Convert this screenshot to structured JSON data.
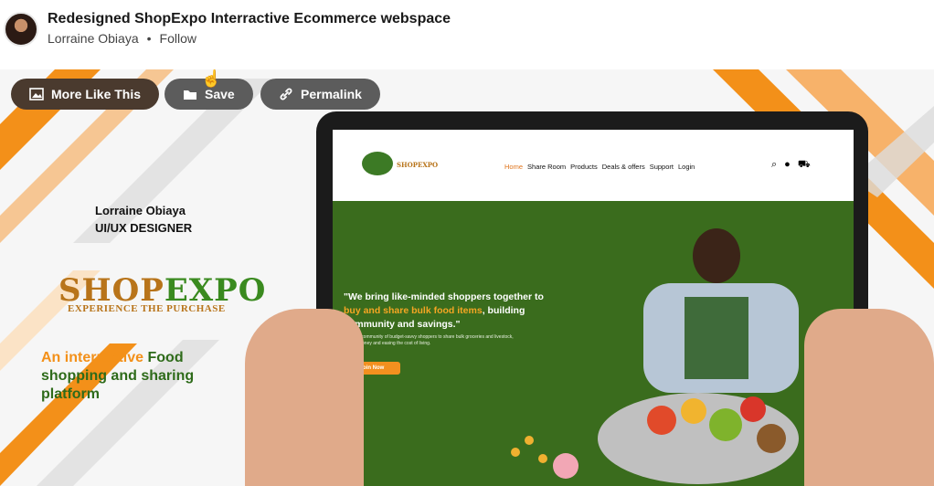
{
  "post": {
    "title": "Redesigned ShopExpo Interractive Ecommerce webspace",
    "author": "Lorraine Obiaya",
    "separator": "•",
    "follow_label": "Follow"
  },
  "actions": {
    "more_like_this": "More Like This",
    "save": "Save",
    "permalink": "Permalink"
  },
  "artwork": {
    "designer_name": "Lorraine Obiaya",
    "designer_role": "UI/UX DESIGNER",
    "logo_part1": "SHOP",
    "logo_part2": "EXPO",
    "logo_tagline": "EXPERIENCE THE PURCHASE",
    "tagline_orange": "An interractive",
    "tagline_green": "Food shopping and sharing platform"
  },
  "website": {
    "logo_text": "SHOPEXPO",
    "nav": [
      "Home",
      "Share Room",
      "Products",
      "Deals & offers",
      "Support",
      "Login"
    ],
    "hero_quote_1": "\"We bring like-minded shoppers together to ",
    "hero_quote_highlight": "buy and share bulk food items",
    "hero_quote_2": ", building community and savings.\"",
    "hero_sub": "Join our community of budget-savvy shoppers to share bulk groceries and livestock, saving money and easing the cost of living.",
    "cta": "Join Now"
  },
  "colors": {
    "orange": "#f39019",
    "green": "#3a6c1d",
    "btn_dark": "#4a3a2e",
    "btn_gray": "#5c5c5c"
  }
}
